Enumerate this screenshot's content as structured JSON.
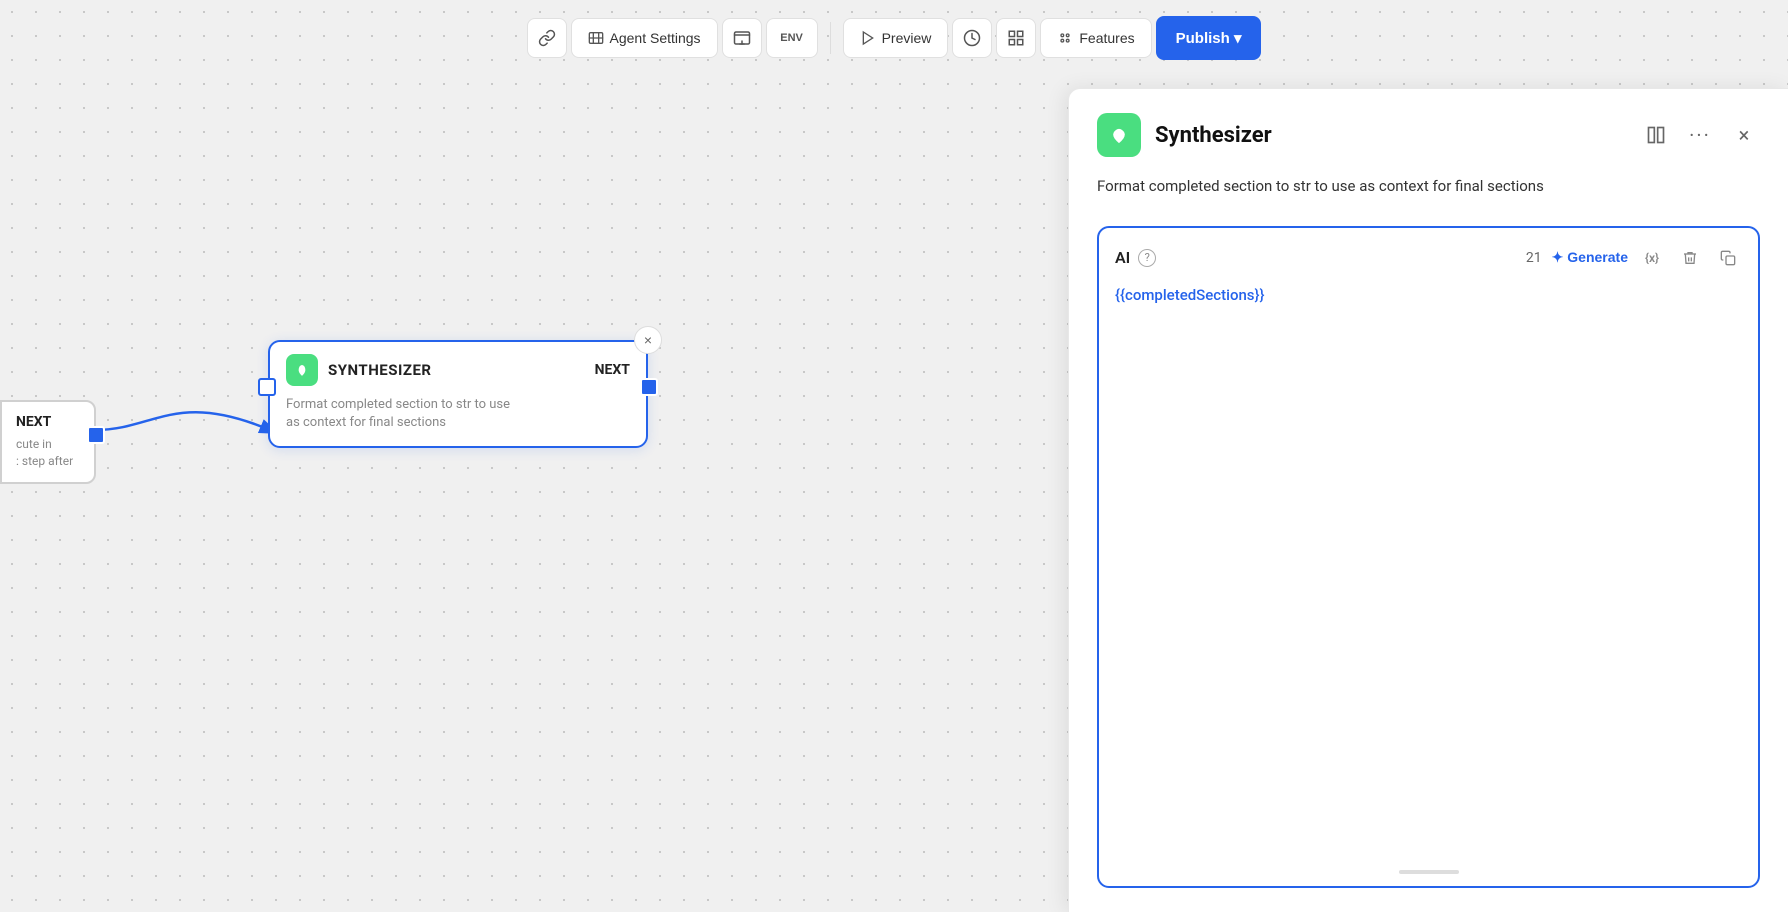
{
  "toolbar": {
    "link_btn": "🔗",
    "agent_settings_label": "Agent Settings",
    "screen_icon": "⛶",
    "env_label": "ENV",
    "preview_label": "Preview",
    "history_icon": "🕐",
    "settings_icon": "⚙",
    "features_label": "Features",
    "publish_label": "Publish ▾"
  },
  "canvas": {
    "prev_node": {
      "next_label": "NEXT",
      "desc_line1": "cute in",
      "desc_line2": ": step after"
    }
  },
  "synthesizer_node": {
    "title": "SYNTHESIZER",
    "next_label": "NEXT",
    "description": "Format completed section to str to use as context for final sections",
    "close": "×"
  },
  "panel": {
    "title": "Synthesizer",
    "description": "Format completed section to str to use as context for final sections",
    "prompt": {
      "label": "AI",
      "count": "21",
      "generate_label": "✦ Generate",
      "variable": "{{completedSections}}",
      "icons": {
        "variable": "{x}",
        "delete": "🗑",
        "copy": "⬜"
      }
    }
  }
}
